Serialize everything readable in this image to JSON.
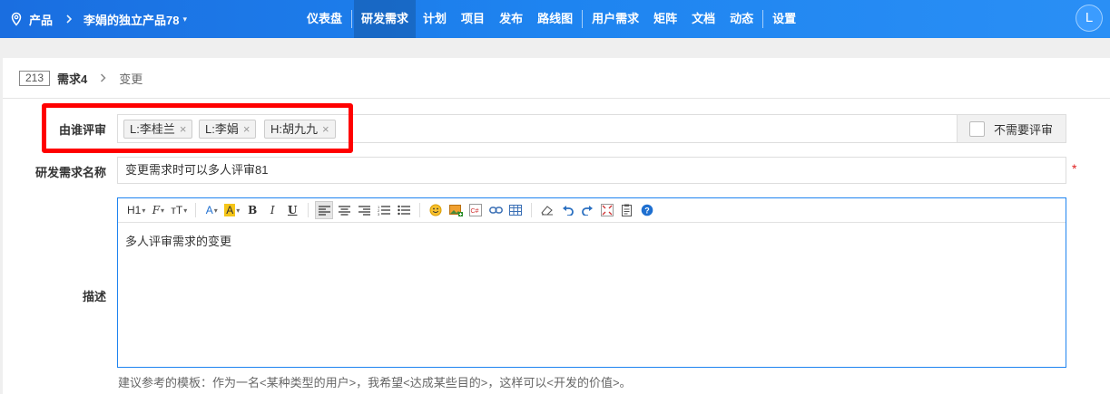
{
  "topbar": {
    "section": "产品",
    "product_name": "李娟的独立产品78",
    "nav": [
      {
        "label": "仪表盘"
      },
      {
        "label": "研发需求"
      },
      {
        "label": "计划"
      },
      {
        "label": "项目"
      },
      {
        "label": "发布"
      },
      {
        "label": "路线图"
      },
      {
        "label": "用户需求"
      },
      {
        "label": "矩阵"
      },
      {
        "label": "文档"
      },
      {
        "label": "动态"
      },
      {
        "label": "设置"
      }
    ],
    "avatar": "L"
  },
  "breadcrumb": {
    "id": "213",
    "title": "需求4",
    "sub": "变更"
  },
  "form": {
    "reviewer_label": "由谁评审",
    "reviewers": [
      "L:李桂兰",
      "L:李娟",
      "H:胡九九"
    ],
    "no_review_label": "不需要评审",
    "title_label": "研发需求名称",
    "title_value": "变更需求时可以多人评审81",
    "required_mark": "*",
    "desc_label": "描述",
    "desc_value": "多人评审需求的变更",
    "hint": "建议参考的模板：作为一名<某种类型的用户>，我希望<达成某些目的>，这样可以<开发的价值>。"
  },
  "toolbar": {
    "heading": "H1",
    "font": "𝓕",
    "size": "тT",
    "font_color": "A",
    "bg_color": "A",
    "bold": "B",
    "italic": "I",
    "underline": "U"
  },
  "colors": {
    "nav_bg": "#1e84f0",
    "highlight_frame": "#ff0000",
    "required": "#e02020"
  }
}
